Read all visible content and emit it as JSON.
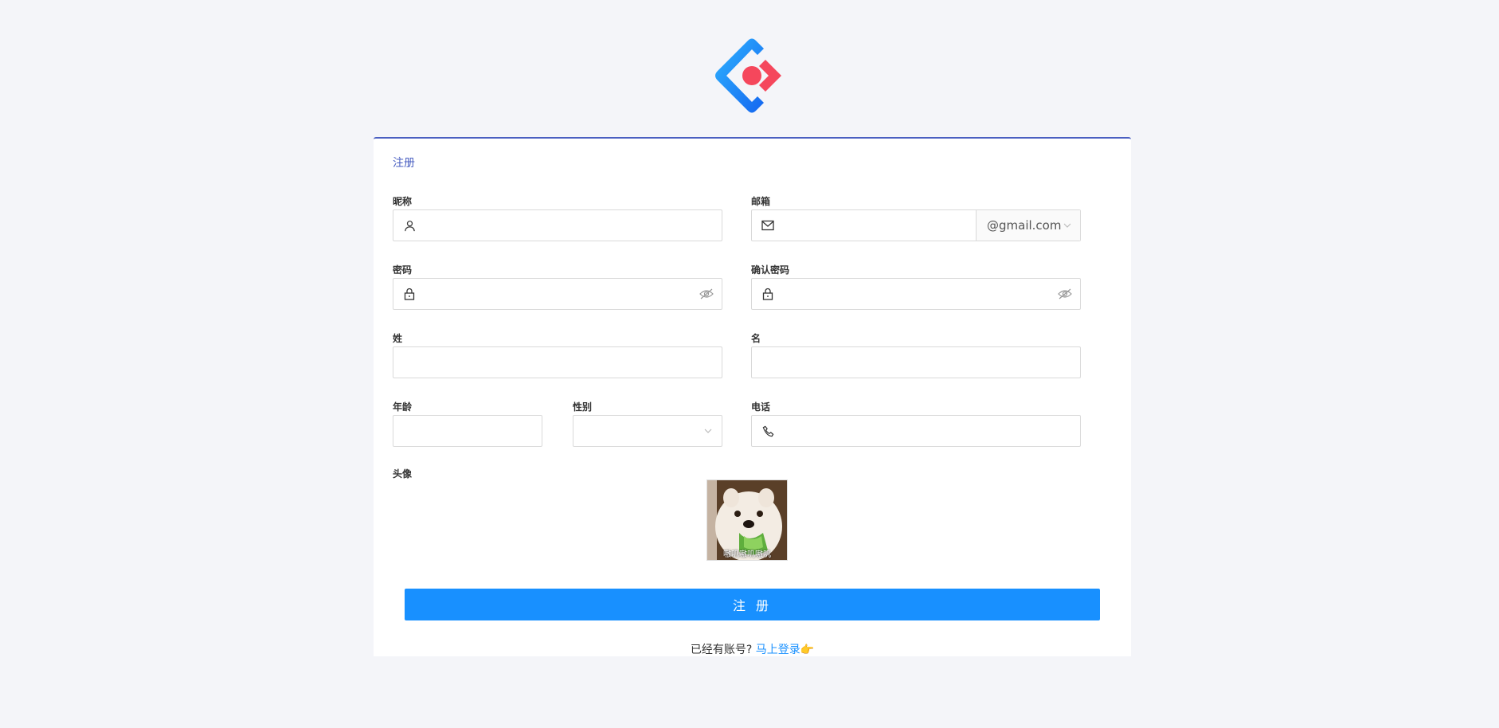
{
  "form": {
    "title": "注册",
    "nickname": {
      "label": "昵称",
      "value": "",
      "icon": "user-icon"
    },
    "email": {
      "label": "邮箱",
      "value": "",
      "icon": "mail-icon",
      "domain": "@gmail.com"
    },
    "password": {
      "label": "密码",
      "value": "",
      "icon": "lock-icon"
    },
    "confirm_password": {
      "label": "确认密码",
      "value": "",
      "icon": "lock-icon"
    },
    "last_name": {
      "label": "姓",
      "value": ""
    },
    "first_name": {
      "label": "名",
      "value": ""
    },
    "age": {
      "label": "年龄",
      "value": ""
    },
    "gender": {
      "label": "性别",
      "value": ""
    },
    "phone": {
      "label": "电话",
      "value": "",
      "icon": "phone-icon"
    },
    "avatar": {
      "label": "头像",
      "caption": "嗷叽嗷叽嗷叽"
    },
    "submit_label": "注 册"
  },
  "footer": {
    "prompt": "已经有账号?",
    "login_link": "马上登录",
    "emoji": "👉"
  },
  "colors": {
    "accent": "#1890ff",
    "title": "#4a5fc1",
    "background": "#f4f5f9"
  }
}
